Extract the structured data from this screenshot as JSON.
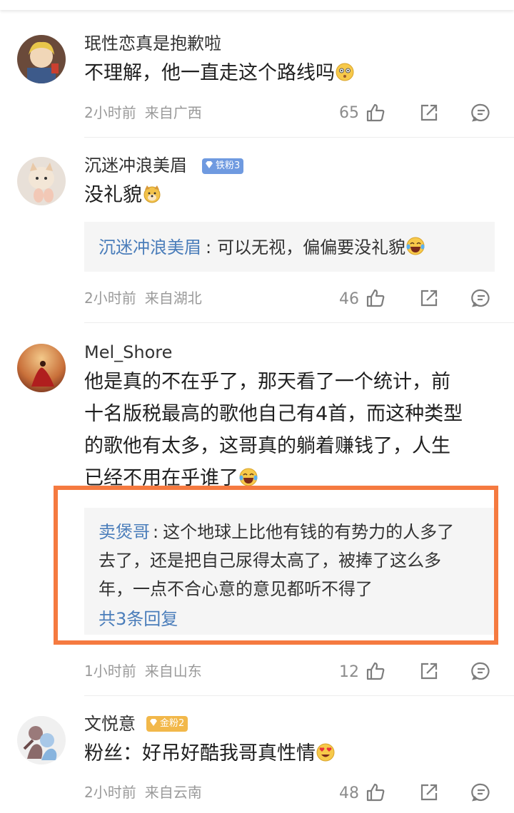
{
  "colors": {
    "accent_link": "#4a7dba",
    "highlight": "#f57a40",
    "meta": "#9a9a9a"
  },
  "comments": [
    {
      "username": "珉性恋真是抱歉啦",
      "text": "不理解，他一直走这个路线吗",
      "emoji": "flushed-face-emoji",
      "time": "2小时前",
      "location": "来自广西",
      "likes": "65"
    },
    {
      "username": "沉迷冲浪美眉",
      "badge": "铁粉3",
      "text": "没礼貌",
      "emoji": "dog-face-emoji",
      "reply": {
        "name": "沉迷冲浪美眉",
        "separator": ":",
        "text": "可以无视，偏偏要没礼貌"
      },
      "time": "2小时前",
      "location": "来自湖北",
      "likes": "46"
    },
    {
      "username": "Mel_Shore",
      "text_lines": [
        "他是真的不在乎了，那天看了一个统计，前",
        "十名版税最高的歌他自己有4首，而这种类型",
        "的歌他有太多，这哥真的躺着赚钱了，人生",
        "已经不用在乎谁了"
      ],
      "reply": {
        "name": "卖煲哥",
        "separator": ":",
        "text_lines": [
          "这个地球上比他有钱的有势力的人多了",
          "去了，还是把自己尿得太高了，被捧了这么多",
          "年，一点不合心意的意见都听不得了"
        ],
        "count": "共3条回复"
      },
      "time": "1小时前",
      "location": "来自山东",
      "likes": "12"
    },
    {
      "username": "文悦意",
      "badge": "金粉2",
      "text": "粉丝：好吊好酷我哥真性情",
      "emoji": "heart-eyes-emoji",
      "time": "2小时前",
      "location": "来自云南",
      "likes": "48"
    }
  ]
}
